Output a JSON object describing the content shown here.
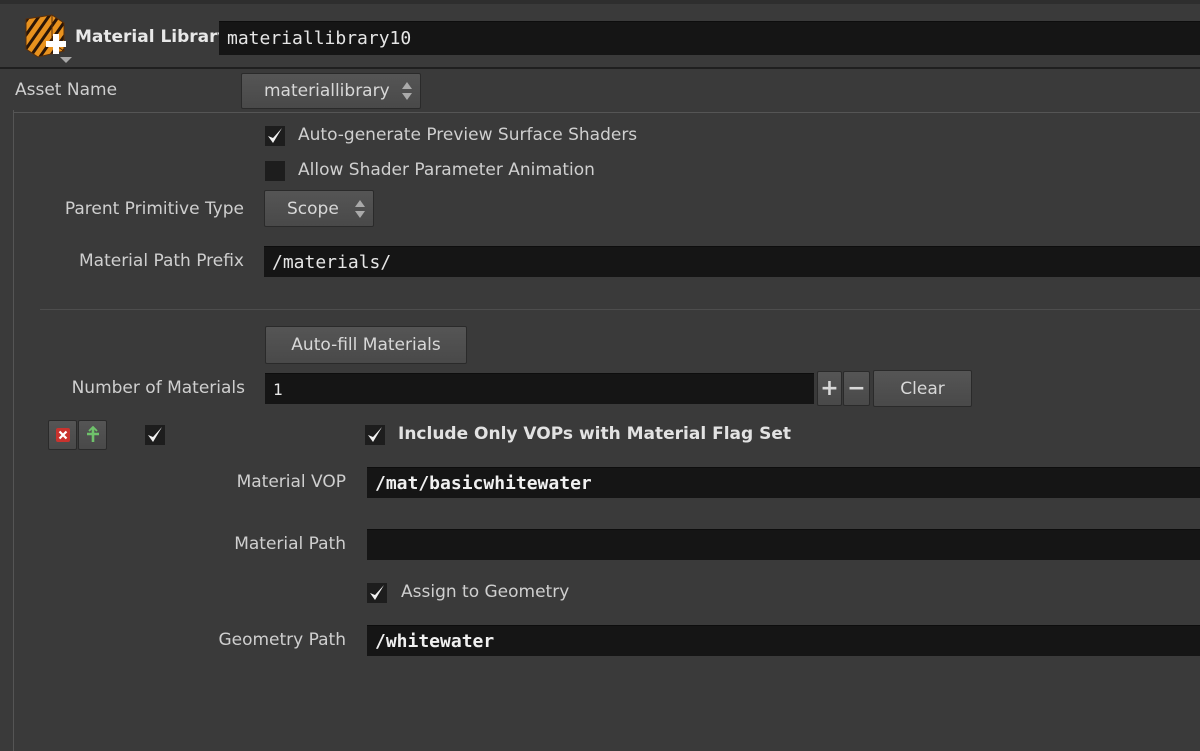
{
  "header": {
    "node_type": "Material Library",
    "node_name": "materiallibrary10"
  },
  "asset_name": {
    "label": "Asset Name",
    "value": "materiallibrary"
  },
  "auto_generate": {
    "label": "Auto-generate Preview Surface Shaders",
    "checked": true
  },
  "allow_animation": {
    "label": "Allow Shader Parameter Animation",
    "checked": false
  },
  "parent_primitive_type": {
    "label": "Parent Primitive Type",
    "value": "Scope"
  },
  "material_path_prefix": {
    "label": "Material Path Prefix",
    "value": "/materials/"
  },
  "autofill_button": "Auto-fill Materials",
  "number_of_materials": {
    "label": "Number of Materials",
    "value": "1",
    "plus": "+",
    "minus": "−",
    "clear_label": "Clear"
  },
  "material_entry": {
    "enabled": true,
    "include_only_vops": {
      "label": "Include Only VOPs with Material Flag Set",
      "checked": true
    },
    "material_vop": {
      "label": "Material VOP",
      "value": "/mat/basicwhitewater"
    },
    "material_path": {
      "label": "Material Path",
      "value": ""
    },
    "assign_to_geometry": {
      "label": "Assign to Geometry",
      "checked": true
    },
    "geometry_path": {
      "label": "Geometry Path",
      "value": "/whitewater"
    }
  },
  "colors": {
    "background": "#3a3a3a",
    "field": "#151515",
    "remove_icon": "#e0504a",
    "insert_icon": "#6fc26b"
  }
}
